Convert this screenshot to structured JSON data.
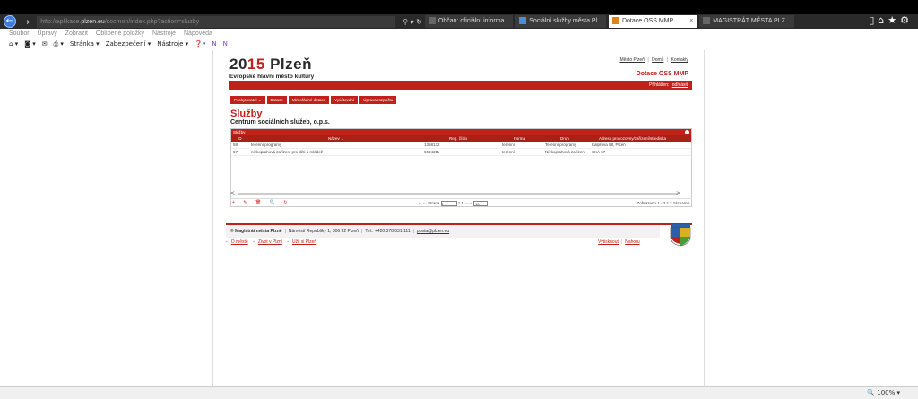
{
  "browser": {
    "url_prefix": "http://aplikace.",
    "url_host": "plzen.eu",
    "url_path": "/socmon/index.php?action=sluzby",
    "tabs": [
      {
        "label": "Občan: oficiální informa..."
      },
      {
        "label": "Sociální služby města Pl..."
      },
      {
        "label": "Dotace OSS MMP",
        "active": true
      },
      {
        "label": "MAGISTRÁT MĚSTA PLZ..."
      }
    ],
    "tab_close": "×",
    "menu": [
      "Soubor",
      "Úpravy",
      "Zobrazit",
      "Oblíbené položky",
      "Nástroje",
      "Nápověda"
    ],
    "commands": [
      "Stránka ▾",
      "Zabezpečení ▾",
      "Nástroje ▾"
    ],
    "zoom": "🔍 100%  ▾"
  },
  "site": {
    "logo_prefix": "20",
    "logo_mark": "15",
    "logo_name": " Plzeň",
    "subtitle": "Evropské hlavní město kultury",
    "links": [
      "Město Plzeň",
      "Domů",
      "Kontakty"
    ],
    "link_sep": "|",
    "app_title": "Dotace OSS MMP",
    "logged_label": "Přihlášen:",
    "logout": "odhlásit"
  },
  "nav": [
    "Poskytovatel ⌄",
    "Dotace",
    "Mimořádné dotace",
    "Vyúčtování",
    "Úprava rozpočtu"
  ],
  "page": {
    "title": "Služby",
    "org": "Centrum sociálních služeb, o.p.s."
  },
  "grid": {
    "caption": "Služby",
    "columns": [
      "ID",
      "Název ⌄",
      "Reg. číslo",
      "Forma",
      "Druh",
      "Adresa provozovny/zařízení/střediska"
    ],
    "rows": [
      [
        "58",
        "terénní programy",
        "1358132",
        "terénní",
        "Terénní programy",
        "Kalpřova 58, Plzeň"
      ],
      [
        "57",
        "nízkoprahová zařízení pro děti a mládež",
        "9694211",
        "terénní",
        "Nízkoprahová zařízení",
        "SKÁ 67"
      ]
    ],
    "scroll_left": "<",
    "scroll_right": ">",
    "pager_nav": "⇤ ⇠",
    "page_label": "Strana",
    "page_value": "1",
    "page_of": "z 1",
    "pager_nav2": "⇢ ⇥",
    "page_size": "10 ▾",
    "summary": "Zobrazeno 1 - 2 z 2 záznamů",
    "tools": "+ ✎ 🗑 🔍 ↻"
  },
  "footer": {
    "org": "© Magistrát města Plzně",
    "address": "Náměstí Republiky 1, 306 32 Plzeň",
    "phone": "Tel.: +420 378 031 111",
    "email": "posta@plzen.eu",
    "sep": "|",
    "links_left": [
      "O městě",
      "Život v Plzni",
      "Užij si Plzeň"
    ],
    "links_right": [
      "Vytisknout",
      "Nahoru"
    ]
  }
}
